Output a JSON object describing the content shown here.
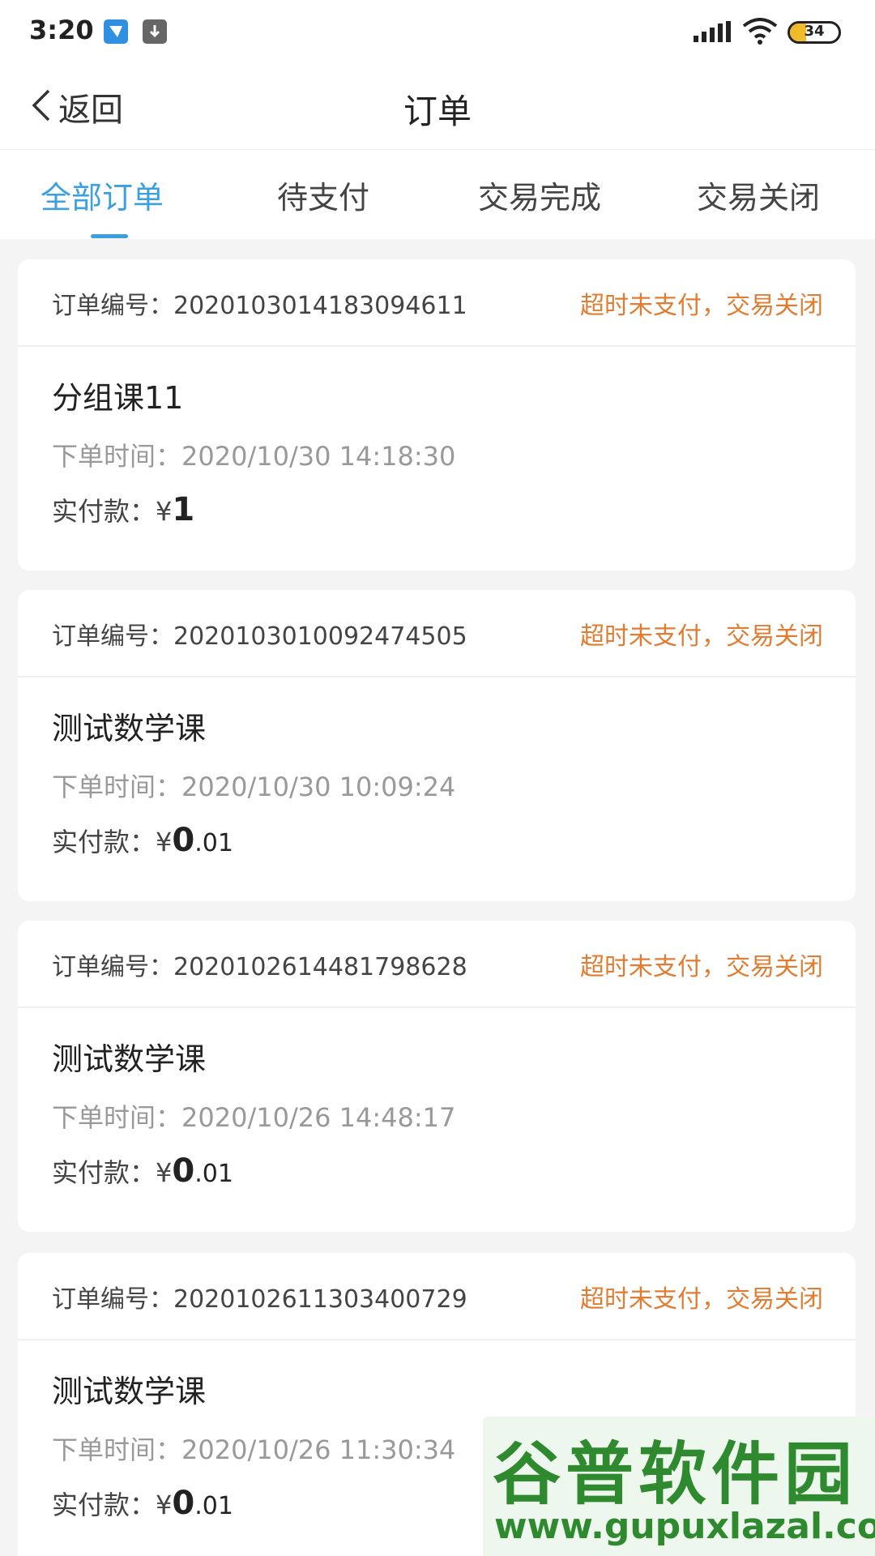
{
  "status_bar": {
    "time": "3:20",
    "battery": "34",
    "colors": {
      "app_icon": "#2f8fe0",
      "battery_fill": "#f2b928"
    },
    "icons": [
      "app-notification-icon",
      "download-icon",
      "signal-icon",
      "wifi-icon",
      "battery-icon"
    ]
  },
  "nav": {
    "back_label": "返回",
    "title": "订单"
  },
  "tabs": [
    {
      "label": "全部订单",
      "active": true
    },
    {
      "label": "待支付",
      "active": false
    },
    {
      "label": "交易完成",
      "active": false
    },
    {
      "label": "交易关闭",
      "active": false
    }
  ],
  "colors": {
    "accent": "#3ba0e0",
    "status_orange": "#e07d33",
    "watermark_green": "#2f8a2f"
  },
  "orders": [
    {
      "order_no": "订单编号：2020103014183094611",
      "status": "超时未支付，交易关闭",
      "title": "分组课11",
      "time": "下单时间：2020/10/30 14:18:30",
      "pay_label": "实付款：",
      "currency": "¥",
      "amount_int": "1",
      "amount_dec": ""
    },
    {
      "order_no": "订单编号：2020103010092474505",
      "status": "超时未支付，交易关闭",
      "title": "测试数学课",
      "time": "下单时间：2020/10/30 10:09:24",
      "pay_label": "实付款：",
      "currency": "¥",
      "amount_int": "0",
      "amount_dec": ".01"
    },
    {
      "order_no": "订单编号：2020102614481798628",
      "status": "超时未支付，交易关闭",
      "title": "测试数学课",
      "time": "下单时间：2020/10/26 14:48:17",
      "pay_label": "实付款：",
      "currency": "¥",
      "amount_int": "0",
      "amount_dec": ".01"
    },
    {
      "order_no": "订单编号：2020102611303400729",
      "status": "超时未支付，交易关闭",
      "title": "测试数学课",
      "time": "下单时间：2020/10/26 11:30:34",
      "pay_label": "实付款：",
      "currency": "¥",
      "amount_int": "0",
      "amount_dec": ".01"
    }
  ],
  "watermark": {
    "main": "谷普软件园",
    "url": "www.gupuxlazal.com"
  }
}
